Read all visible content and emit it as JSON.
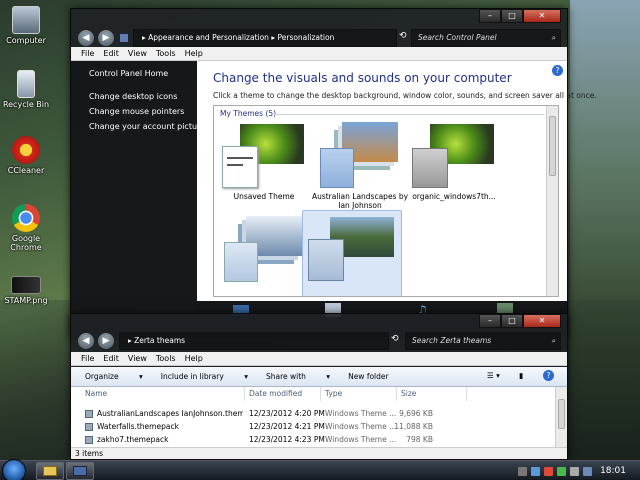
{
  "desktop": {
    "icons": [
      {
        "label": "Computer"
      },
      {
        "label": "Recycle Bin"
      },
      {
        "label": "CCleaner"
      },
      {
        "label": "Google Chrome"
      },
      {
        "label": "STAMP.png"
      }
    ]
  },
  "personalization": {
    "breadcrumb": [
      "Appearance and Personalization",
      "Personalization"
    ],
    "search_placeholder": "Search Control Panel",
    "menu": [
      "File",
      "Edit",
      "View",
      "Tools",
      "Help"
    ],
    "left_links": [
      "Control Panel Home",
      "Change desktop icons",
      "Change mouse pointers",
      "Change your account picture"
    ],
    "heading": "Change the visuals and sounds on your computer",
    "subheading": "Click a theme to change the desktop background, window color, sounds, and screen saver all at once.",
    "group_label": "My Themes (5)",
    "themes": [
      {
        "name": "Unsaved Theme",
        "selected": false
      },
      {
        "name": "Australian Landscapes by Ian Johnson",
        "selected": false
      },
      {
        "name": "organic_windows7th...",
        "selected": false
      },
      {
        "name": "",
        "selected": false
      },
      {
        "name": "",
        "selected": true
      }
    ]
  },
  "explorer": {
    "path": "Zerta theams",
    "search_placeholder": "Search Zerta theams",
    "menu": [
      "File",
      "Edit",
      "View",
      "Tools",
      "Help"
    ],
    "toolbar": [
      "Organize",
      "Include in library",
      "Share with",
      "New folder"
    ],
    "columns": [
      "Name",
      "Date modified",
      "Type",
      "Size"
    ],
    "files": [
      {
        "name": "AustralianLandscapes IanJohnson.theme...",
        "date": "12/23/2012 4:20 PM",
        "type": "Windows Theme ...",
        "size": "9,696 KB"
      },
      {
        "name": "Waterfalls.themepack",
        "date": "12/23/2012 4:21 PM",
        "type": "Windows Theme ...",
        "size": "11,088 KB"
      },
      {
        "name": "zakho7.themepack",
        "date": "12/23/2012 4:23 PM",
        "type": "Windows Theme ...",
        "size": "798 KB"
      }
    ],
    "status": "3 items"
  },
  "taskbar": {
    "clock": "18:01"
  }
}
